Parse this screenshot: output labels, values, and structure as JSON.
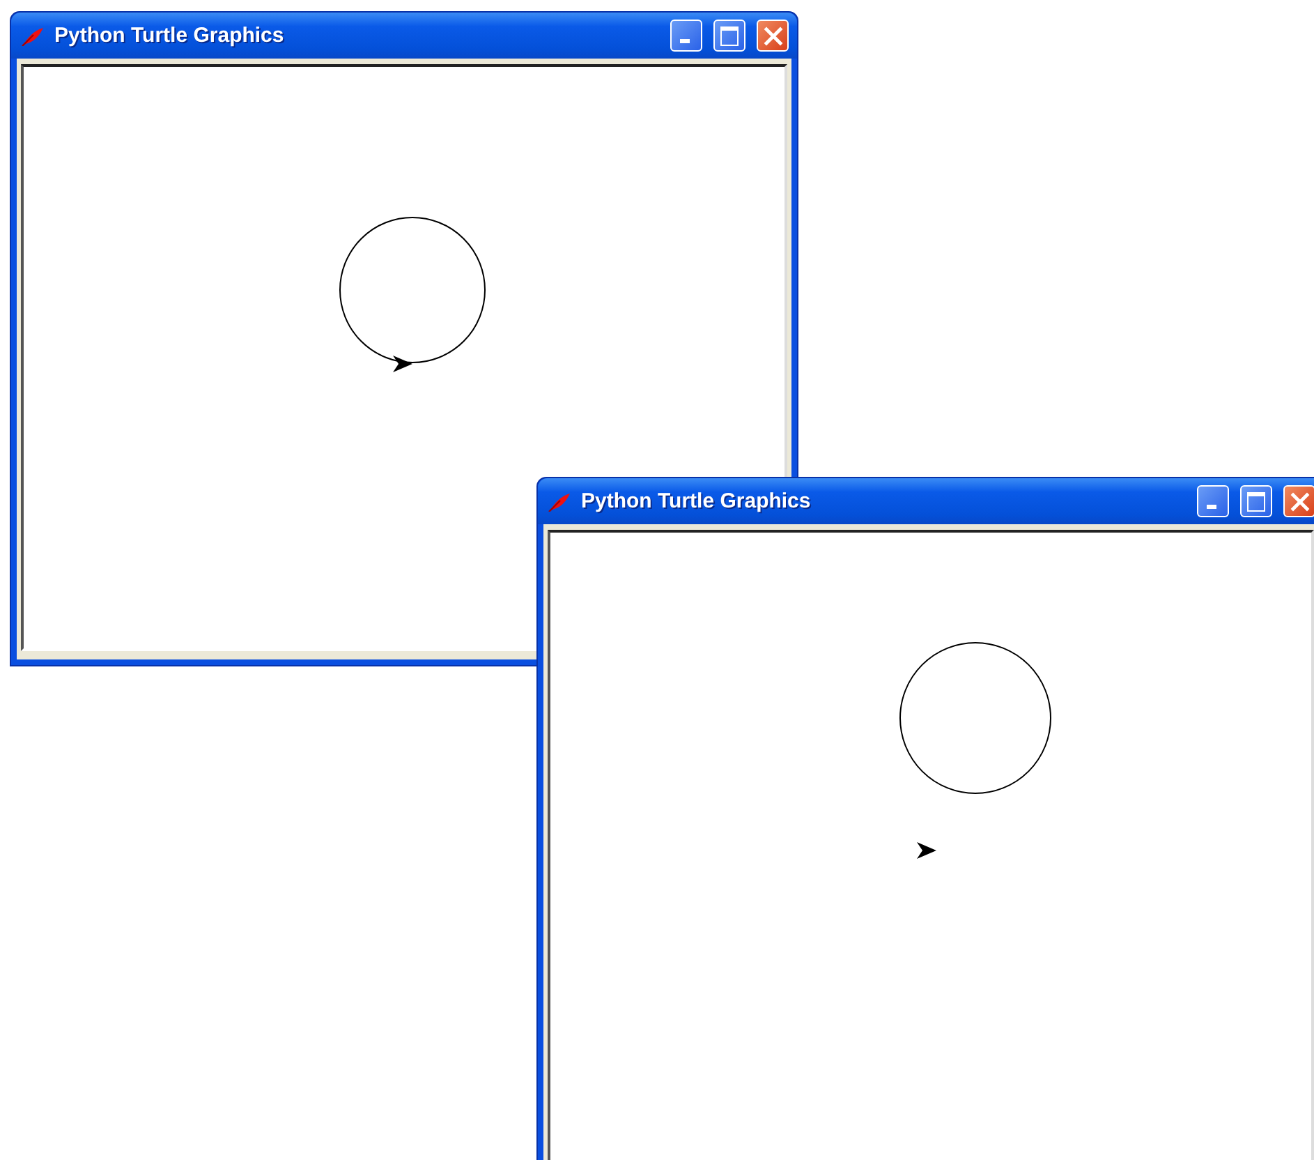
{
  "windows": [
    {
      "title": "Python Turtle Graphics"
    },
    {
      "title": "Python Turtle Graphics"
    }
  ]
}
